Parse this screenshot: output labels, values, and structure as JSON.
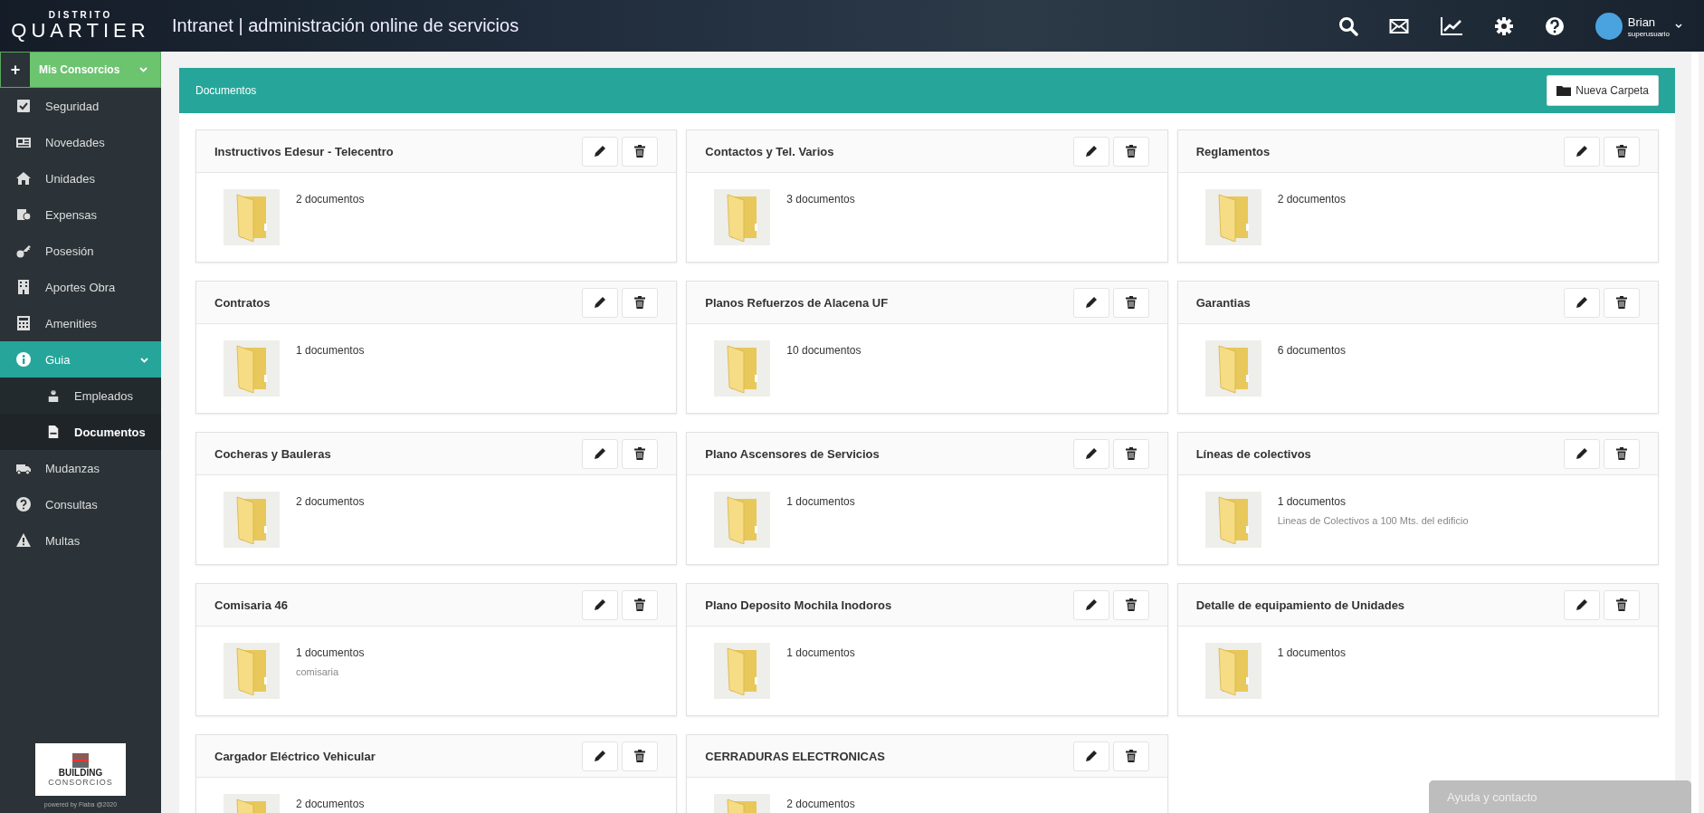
{
  "header": {
    "brand_top": "DISTRITO",
    "brand": "QUARTIER",
    "title": "Intranet | administración online de servicios",
    "user": {
      "name": "Brian",
      "role": "superusuario"
    }
  },
  "sidebar": {
    "consorcios": {
      "label": "Mis Consorcios",
      "add": "+"
    },
    "items": [
      {
        "label": "Seguridad",
        "selected": false
      },
      {
        "label": "Novedades",
        "selected": false
      },
      {
        "label": "Unidades",
        "selected": false
      },
      {
        "label": "Expensas",
        "selected": false
      },
      {
        "label": "Posesión",
        "selected": false
      },
      {
        "label": "Aportes Obra",
        "selected": false
      },
      {
        "label": "Amenities",
        "selected": false
      },
      {
        "label": "Guia",
        "selected": true,
        "expanded": true,
        "children": [
          {
            "label": "Empleados",
            "selected": false
          },
          {
            "label": "Documentos",
            "selected": true
          }
        ]
      },
      {
        "label": "Mudanzas",
        "selected": false
      },
      {
        "label": "Consultas",
        "selected": false
      },
      {
        "label": "Multas",
        "selected": false
      }
    ],
    "footer_logo": {
      "name": "BUILDING",
      "sub": "CONSORCIOS"
    },
    "powered": "powered by Fiaba @2020"
  },
  "panel": {
    "title": "Documentos",
    "new_folder": "Nueva Carpeta",
    "folders": [
      {
        "title": "Instructivos Edesur - Telecentro",
        "count": "2 documentos"
      },
      {
        "title": "Contactos y Tel. Varios",
        "count": "3 documentos"
      },
      {
        "title": "Reglamentos",
        "count": "2 documentos"
      },
      {
        "title": "Contratos",
        "count": "1 documentos"
      },
      {
        "title": "Planos Refuerzos de Alacena UF",
        "count": "10 documentos"
      },
      {
        "title": "Garantias",
        "count": "6 documentos"
      },
      {
        "title": "Cocheras y Bauleras",
        "count": "2 documentos"
      },
      {
        "title": "Plano Ascensores de Servicios",
        "count": "1 documentos"
      },
      {
        "title": "Líneas de colectivos",
        "count": "1 documentos",
        "description": "Lineas de Colectivos a 100 Mts. del edificio"
      },
      {
        "title": "Comisaria 46",
        "count": "1 documentos",
        "description": "comisaria"
      },
      {
        "title": "Plano Deposito Mochila Inodoros",
        "count": "1 documentos"
      },
      {
        "title": "Detalle de equipamiento de Unidades",
        "count": "1 documentos"
      },
      {
        "title": "Cargador Eléctrico Vehicular",
        "count": "2 documentos"
      },
      {
        "title": "CERRADURAS ELECTRONICAS",
        "count": "2 documentos"
      }
    ]
  },
  "help": {
    "label": "Ayuda y contacto"
  }
}
